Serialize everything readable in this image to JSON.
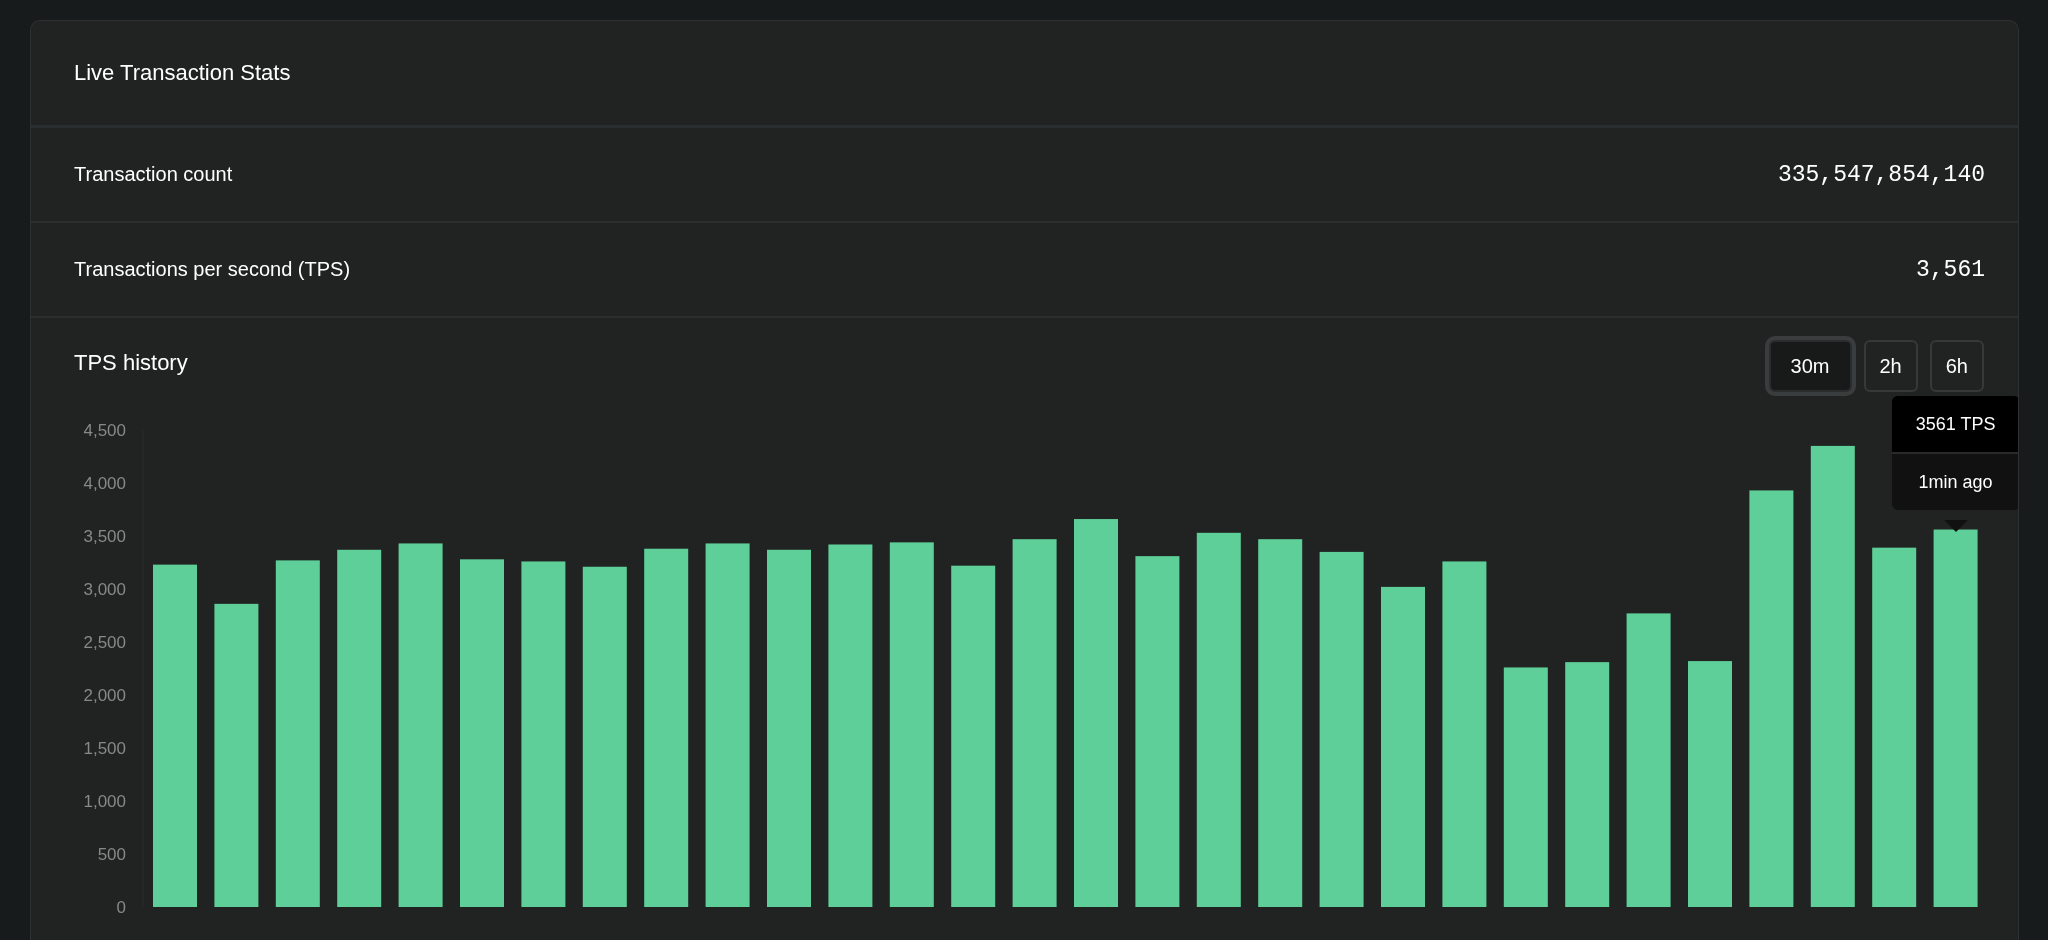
{
  "card": {
    "title": "Live Transaction Stats"
  },
  "stats": [
    {
      "label": "Transaction count",
      "value": "335,547,854,140"
    },
    {
      "label": "Transactions per second (TPS)",
      "value": "3,561"
    }
  ],
  "history": {
    "title": "TPS history",
    "ranges": [
      {
        "label": "30m",
        "selected": true
      },
      {
        "label": "2h",
        "selected": false
      },
      {
        "label": "6h",
        "selected": false
      }
    ],
    "tooltip": {
      "value": "3561 TPS",
      "time": "1min ago"
    },
    "chart_data": {
      "type": "bar",
      "ylim": [
        0,
        4500
      ],
      "yticks": [
        {
          "value": 0,
          "label": "0"
        },
        {
          "value": 500,
          "label": "500"
        },
        {
          "value": 1000,
          "label": "1,000"
        },
        {
          "value": 1500,
          "label": "1,500"
        },
        {
          "value": 2000,
          "label": "2,000"
        },
        {
          "value": 2500,
          "label": "2,500"
        },
        {
          "value": 3000,
          "label": "3,000"
        },
        {
          "value": 3500,
          "label": "3,500"
        },
        {
          "value": 4000,
          "label": "4,000"
        },
        {
          "value": 4500,
          "label": "4,500"
        }
      ],
      "series": [
        {
          "color": "#5ecf98",
          "values": [
            3230,
            2860,
            3270,
            3370,
            3430,
            3280,
            3260,
            3210,
            3380,
            3430,
            3370,
            3420,
            3440,
            3220,
            3470,
            3660,
            3310,
            3530,
            3470,
            3350,
            3020,
            3260,
            2260,
            2310,
            2770,
            2320,
            3930,
            4350,
            3390,
            3561
          ]
        }
      ]
    }
  }
}
